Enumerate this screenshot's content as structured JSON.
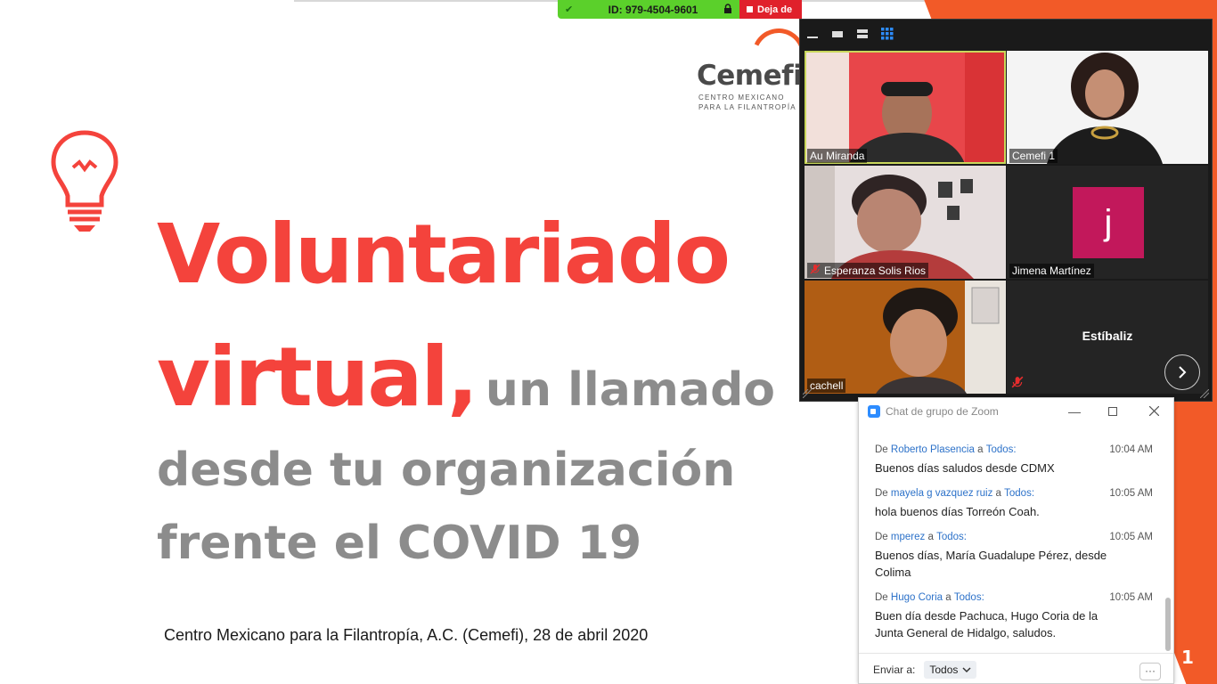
{
  "meeting": {
    "id_label": "ID: 979-4504-9601",
    "stop_share_label": "Deja de"
  },
  "slide": {
    "logo_word": "Cemefi",
    "logo_sub1": "CENTRO MEXICANO",
    "logo_sub2": "PARA LA FILANTROPÍA",
    "title_line1": "Voluntariado",
    "title_line2_big": "virtual,",
    "title_line2_small": "un llamado",
    "title_line3": "desde tu organización",
    "title_line4": "frente el COVID 19",
    "footer": "Centro Mexicano para la Filantropía, A.C. (Cemefi), 28 de abril 2020",
    "slide_number": "1",
    "colors": {
      "accent_red": "#f4433c",
      "accent_orange": "#f25a28",
      "gray_text": "#8c8c8c"
    }
  },
  "gallery": {
    "participants": [
      {
        "name": "Au Miranda",
        "muted": false,
        "active_speaker": true
      },
      {
        "name": "Cemefi 1",
        "muted": false,
        "active_speaker": false
      },
      {
        "name": "Esperanza Solis Rios",
        "muted": true,
        "active_speaker": false
      },
      {
        "name": "Jimena Martínez",
        "muted": false,
        "active_speaker": false,
        "avatar_letter": "j"
      },
      {
        "name": "cachell",
        "muted": false,
        "active_speaker": false
      },
      {
        "name": "Estíbaliz",
        "muted": true,
        "active_speaker": false
      }
    ]
  },
  "chat": {
    "title": "Chat de grupo de Zoom",
    "messages": [
      {
        "from_prefix": "De",
        "sender": "Roberto Plasencia",
        "to_word": "a",
        "recipient": "Todos:",
        "time": "10:04 AM",
        "text": "Buenos días saludos desde CDMX"
      },
      {
        "from_prefix": "De",
        "sender": "mayela g vazquez ruiz",
        "to_word": "a",
        "recipient": "Todos:",
        "time": "10:05 AM",
        "text": "hola buenos días Torreón Coah."
      },
      {
        "from_prefix": "De",
        "sender": "mperez",
        "to_word": "a",
        "recipient": "Todos:",
        "time": "10:05 AM",
        "text": "Buenos días, María Guadalupe Pérez, desde Colima"
      },
      {
        "from_prefix": "De",
        "sender": "Hugo Coria",
        "to_word": "a",
        "recipient": "Todos:",
        "time": "10:05 AM",
        "text": "Buen día desde Pachuca, Hugo Coria de la Junta General de Hidalgo, saludos."
      }
    ],
    "send_to_label": "Enviar a:",
    "send_to_value": "Todos",
    "more_label": "···"
  }
}
